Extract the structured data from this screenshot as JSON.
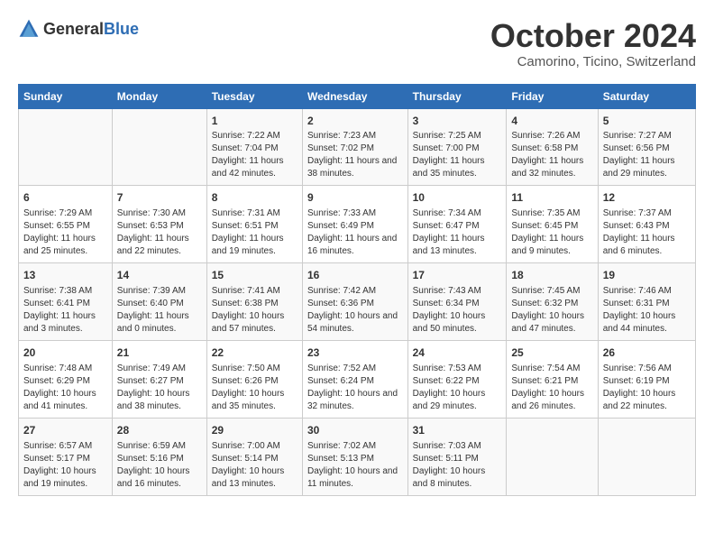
{
  "header": {
    "logo_general": "General",
    "logo_blue": "Blue",
    "month_year": "October 2024",
    "location": "Camorino, Ticino, Switzerland"
  },
  "weekdays": [
    "Sunday",
    "Monday",
    "Tuesday",
    "Wednesday",
    "Thursday",
    "Friday",
    "Saturday"
  ],
  "weeks": [
    [
      {
        "day": "",
        "content": ""
      },
      {
        "day": "",
        "content": ""
      },
      {
        "day": "1",
        "content": "Sunrise: 7:22 AM\nSunset: 7:04 PM\nDaylight: 11 hours and 42 minutes."
      },
      {
        "day": "2",
        "content": "Sunrise: 7:23 AM\nSunset: 7:02 PM\nDaylight: 11 hours and 38 minutes."
      },
      {
        "day": "3",
        "content": "Sunrise: 7:25 AM\nSunset: 7:00 PM\nDaylight: 11 hours and 35 minutes."
      },
      {
        "day": "4",
        "content": "Sunrise: 7:26 AM\nSunset: 6:58 PM\nDaylight: 11 hours and 32 minutes."
      },
      {
        "day": "5",
        "content": "Sunrise: 7:27 AM\nSunset: 6:56 PM\nDaylight: 11 hours and 29 minutes."
      }
    ],
    [
      {
        "day": "6",
        "content": "Sunrise: 7:29 AM\nSunset: 6:55 PM\nDaylight: 11 hours and 25 minutes."
      },
      {
        "day": "7",
        "content": "Sunrise: 7:30 AM\nSunset: 6:53 PM\nDaylight: 11 hours and 22 minutes."
      },
      {
        "day": "8",
        "content": "Sunrise: 7:31 AM\nSunset: 6:51 PM\nDaylight: 11 hours and 19 minutes."
      },
      {
        "day": "9",
        "content": "Sunrise: 7:33 AM\nSunset: 6:49 PM\nDaylight: 11 hours and 16 minutes."
      },
      {
        "day": "10",
        "content": "Sunrise: 7:34 AM\nSunset: 6:47 PM\nDaylight: 11 hours and 13 minutes."
      },
      {
        "day": "11",
        "content": "Sunrise: 7:35 AM\nSunset: 6:45 PM\nDaylight: 11 hours and 9 minutes."
      },
      {
        "day": "12",
        "content": "Sunrise: 7:37 AM\nSunset: 6:43 PM\nDaylight: 11 hours and 6 minutes."
      }
    ],
    [
      {
        "day": "13",
        "content": "Sunrise: 7:38 AM\nSunset: 6:41 PM\nDaylight: 11 hours and 3 minutes."
      },
      {
        "day": "14",
        "content": "Sunrise: 7:39 AM\nSunset: 6:40 PM\nDaylight: 11 hours and 0 minutes."
      },
      {
        "day": "15",
        "content": "Sunrise: 7:41 AM\nSunset: 6:38 PM\nDaylight: 10 hours and 57 minutes."
      },
      {
        "day": "16",
        "content": "Sunrise: 7:42 AM\nSunset: 6:36 PM\nDaylight: 10 hours and 54 minutes."
      },
      {
        "day": "17",
        "content": "Sunrise: 7:43 AM\nSunset: 6:34 PM\nDaylight: 10 hours and 50 minutes."
      },
      {
        "day": "18",
        "content": "Sunrise: 7:45 AM\nSunset: 6:32 PM\nDaylight: 10 hours and 47 minutes."
      },
      {
        "day": "19",
        "content": "Sunrise: 7:46 AM\nSunset: 6:31 PM\nDaylight: 10 hours and 44 minutes."
      }
    ],
    [
      {
        "day": "20",
        "content": "Sunrise: 7:48 AM\nSunset: 6:29 PM\nDaylight: 10 hours and 41 minutes."
      },
      {
        "day": "21",
        "content": "Sunrise: 7:49 AM\nSunset: 6:27 PM\nDaylight: 10 hours and 38 minutes."
      },
      {
        "day": "22",
        "content": "Sunrise: 7:50 AM\nSunset: 6:26 PM\nDaylight: 10 hours and 35 minutes."
      },
      {
        "day": "23",
        "content": "Sunrise: 7:52 AM\nSunset: 6:24 PM\nDaylight: 10 hours and 32 minutes."
      },
      {
        "day": "24",
        "content": "Sunrise: 7:53 AM\nSunset: 6:22 PM\nDaylight: 10 hours and 29 minutes."
      },
      {
        "day": "25",
        "content": "Sunrise: 7:54 AM\nSunset: 6:21 PM\nDaylight: 10 hours and 26 minutes."
      },
      {
        "day": "26",
        "content": "Sunrise: 7:56 AM\nSunset: 6:19 PM\nDaylight: 10 hours and 22 minutes."
      }
    ],
    [
      {
        "day": "27",
        "content": "Sunrise: 6:57 AM\nSunset: 5:17 PM\nDaylight: 10 hours and 19 minutes."
      },
      {
        "day": "28",
        "content": "Sunrise: 6:59 AM\nSunset: 5:16 PM\nDaylight: 10 hours and 16 minutes."
      },
      {
        "day": "29",
        "content": "Sunrise: 7:00 AM\nSunset: 5:14 PM\nDaylight: 10 hours and 13 minutes."
      },
      {
        "day": "30",
        "content": "Sunrise: 7:02 AM\nSunset: 5:13 PM\nDaylight: 10 hours and 11 minutes."
      },
      {
        "day": "31",
        "content": "Sunrise: 7:03 AM\nSunset: 5:11 PM\nDaylight: 10 hours and 8 minutes."
      },
      {
        "day": "",
        "content": ""
      },
      {
        "day": "",
        "content": ""
      }
    ]
  ]
}
